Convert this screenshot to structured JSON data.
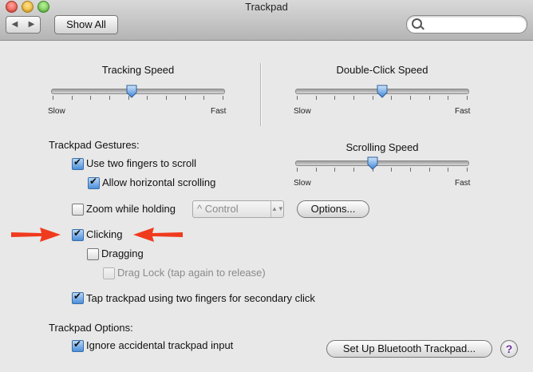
{
  "window": {
    "title": "Trackpad"
  },
  "toolbar": {
    "back_icon": "◀",
    "forward_icon": "▶",
    "show_all_label": "Show All",
    "search_placeholder": "",
    "search_value": ""
  },
  "sliders": {
    "tracking": {
      "label": "Tracking Speed",
      "min_label": "Slow",
      "max_label": "Fast",
      "value": 0.46,
      "ticks": 10
    },
    "double_click": {
      "label": "Double-Click Speed",
      "min_label": "Slow",
      "max_label": "Fast",
      "value": 0.5,
      "ticks": 10
    },
    "scrolling": {
      "label": "Scrolling Speed",
      "min_label": "Slow",
      "max_label": "Fast",
      "value": 0.44,
      "ticks": 10
    }
  },
  "gestures": {
    "title": "Trackpad Gestures:",
    "two_finger_scroll": {
      "label": "Use two fingers to scroll",
      "checked": true
    },
    "horizontal_scroll": {
      "label": "Allow horizontal scrolling",
      "checked": true
    },
    "zoom_holding": {
      "label": "Zoom while holding",
      "checked": false
    },
    "zoom_key": {
      "value": "^ Control",
      "arrows": "▲▼"
    },
    "options_label": "Options...",
    "clicking": {
      "label": "Clicking",
      "checked": true
    },
    "dragging": {
      "label": "Dragging",
      "checked": false
    },
    "drag_lock": {
      "label": "Drag Lock (tap again to release)",
      "checked": false,
      "enabled": false
    },
    "secondary_click": {
      "label": "Tap trackpad using two fingers for secondary click",
      "checked": true
    }
  },
  "trackpad_options": {
    "title": "Trackpad Options:",
    "ignore_accidental": {
      "label": "Ignore accidental trackpad input",
      "checked": true
    },
    "bluetooth_button": "Set Up Bluetooth Trackpad...",
    "help_label": "?"
  },
  "annotations": {
    "arrow_color": "#f03a1e"
  }
}
